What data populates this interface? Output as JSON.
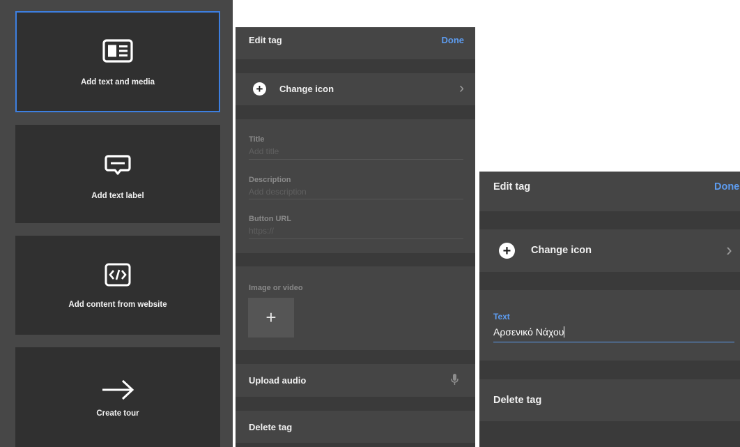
{
  "tag_types": {
    "text_media": {
      "label": "Add text and media",
      "icon": "text-media-icon"
    },
    "text_label": {
      "label": "Add text label",
      "icon": "text-label-icon"
    },
    "website": {
      "label": "Add content from website",
      "icon": "code-icon"
    },
    "tour": {
      "label": "Create tour",
      "icon": "arrow-right-icon"
    }
  },
  "edit_tag_full": {
    "title": "Edit tag",
    "done": "Done",
    "change_icon": "Change icon",
    "title_label": "Title",
    "title_placeholder": "Add title",
    "description_label": "Description",
    "description_placeholder": "Add description",
    "button_url_label": "Button URL",
    "button_url_placeholder": "https://",
    "image_label": "Image or video",
    "upload_audio": "Upload audio",
    "delete": "Delete tag"
  },
  "edit_tag_label": {
    "title": "Edit tag",
    "done": "Done",
    "change_icon": "Change icon",
    "text_label": "Text",
    "text_value": "Αρσενικό Νάχου",
    "delete": "Delete tag"
  },
  "colors": {
    "accent": "#5d9cf0",
    "selected_border": "#3d7fe0",
    "panel_bg": "#3c3c3c",
    "card_bg": "#303030"
  }
}
